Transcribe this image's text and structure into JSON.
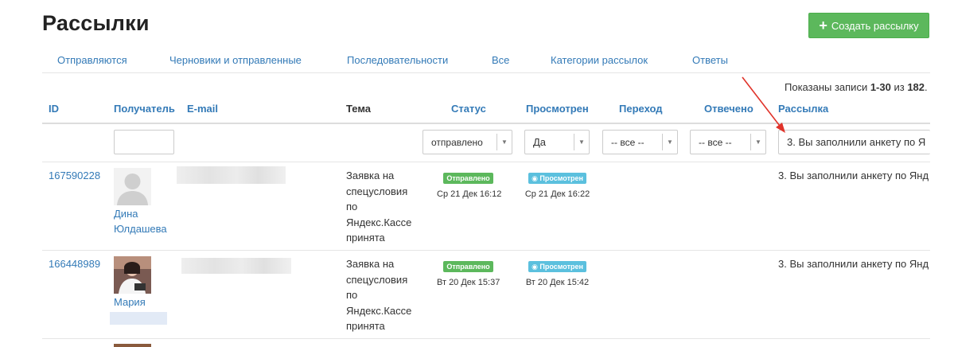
{
  "page": {
    "title": "Рассылки"
  },
  "create_button": {
    "label": "Создать рассылку"
  },
  "tabs": [
    {
      "label": "Отправляются"
    },
    {
      "label": "Черновики и отправленные"
    },
    {
      "label": "Последовательности"
    },
    {
      "label": "Все"
    },
    {
      "label": "Категории рассылок"
    },
    {
      "label": "Ответы"
    }
  ],
  "records": {
    "prefix": "Показаны записи ",
    "range": "1-30",
    "middle": " из ",
    "total": "182",
    "suffix": "."
  },
  "columns": {
    "id": "ID",
    "recipient": "Получатель",
    "email": "E-mail",
    "subject": "Тема",
    "status": "Статус",
    "viewed": "Просмотрен",
    "clicked": "Переход",
    "replied": "Отвечено",
    "campaign": "Рассылка"
  },
  "filters": {
    "recipient_value": "",
    "status": "отправлено",
    "viewed": "Да",
    "clicked": "-- все --",
    "replied": "-- все --",
    "campaign": "3. Вы заполнили анкету по Я"
  },
  "rows": [
    {
      "id": "167590228",
      "name": "Дина Юлдашева",
      "name_line1": "Дина",
      "name_line2": "Юлдашева",
      "subject_lines": [
        "Заявка на",
        "спецусловия",
        "по",
        "Яндекс.Кассе",
        "принята"
      ],
      "status_badge": "Отправлено",
      "status_date": "Ср 21 Дек 16:12",
      "viewed_badge": "Просмотрен",
      "viewed_date": "Ср 21 Дек 16:22",
      "campaign": "3. Вы заполнили анкету по Янд"
    },
    {
      "id": "166448989",
      "name": "Мария",
      "name_line1": "Мария",
      "name_line2": "",
      "subject_lines": [
        "Заявка на",
        "спецусловия",
        "по",
        "Яндекс.Кассе",
        "принята"
      ],
      "status_badge": "Отправлено",
      "status_date": "Вт 20 Дек 15:37",
      "viewed_badge": "Просмотрен",
      "viewed_date": "Вт 20 Дек 15:42",
      "campaign": "3. Вы заполнили анкету по Янд"
    }
  ],
  "colors": {
    "link": "#337ab7",
    "success": "#5cb85c",
    "info": "#5bc0de",
    "annotation_arrow": "#e0332a"
  },
  "icons": {
    "create": "plus-icon",
    "viewed": "eye-icon",
    "dropdown": "caret-down-icon",
    "avatar_default": "user-silhouette-icon",
    "annotation": "red-arrow-icon"
  }
}
